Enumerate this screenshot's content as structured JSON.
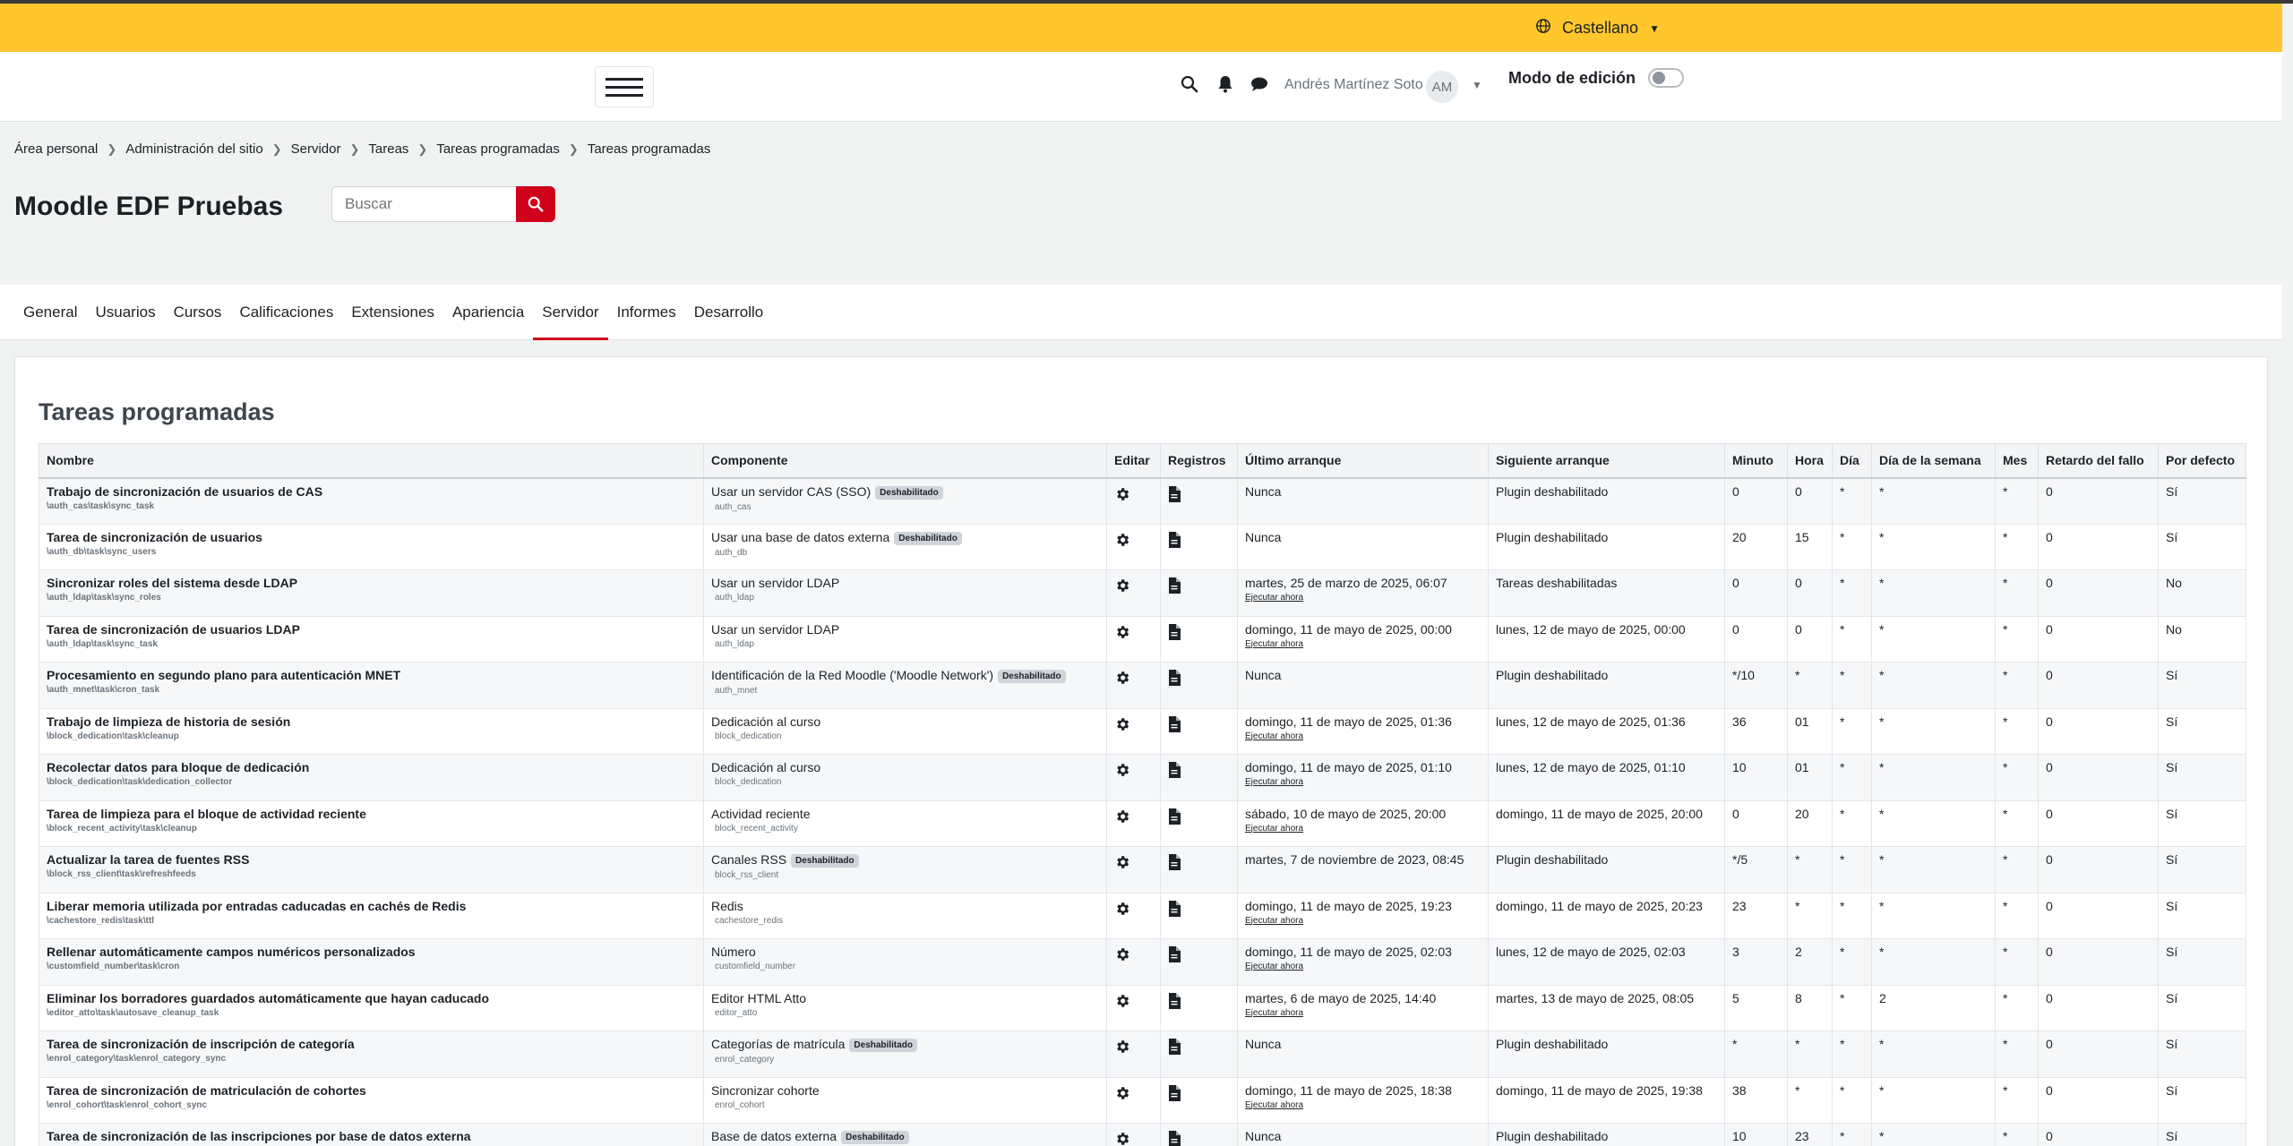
{
  "lang": {
    "label": "Castellano",
    "icon": "globe-icon"
  },
  "navbar": {
    "user_name": "Andrés Martínez Soto",
    "user_initials": "AM",
    "edit_mode_label": "Modo de edición",
    "icons": [
      "search-icon",
      "bell-icon",
      "chat-icon"
    ]
  },
  "breadcrumb": [
    "Área personal",
    "Administración del sitio",
    "Servidor",
    "Tareas",
    "Tareas programadas",
    "Tareas programadas"
  ],
  "site_title": "Moodle EDF Pruebas",
  "search": {
    "placeholder": "Buscar"
  },
  "tabs": [
    {
      "label": "General"
    },
    {
      "label": "Usuarios"
    },
    {
      "label": "Cursos"
    },
    {
      "label": "Calificaciones"
    },
    {
      "label": "Extensiones"
    },
    {
      "label": "Apariencia"
    },
    {
      "label": "Servidor",
      "active": true
    },
    {
      "label": "Informes"
    },
    {
      "label": "Desarrollo"
    }
  ],
  "page_title": "Tareas programadas",
  "table": {
    "headers": {
      "name": "Nombre",
      "component": "Componente",
      "edit": "Editar",
      "logs": "Registros",
      "last_run": "Último arranque",
      "next_run": "Siguiente arranque",
      "minute": "Minuto",
      "hour": "Hora",
      "day": "Día",
      "day_of_week": "Día de la semana",
      "month": "Mes",
      "fail_delay": "Retardo del fallo",
      "default": "Por defecto"
    },
    "run_now_label": "Ejecutar ahora",
    "rows": [
      {
        "name": "Trabajo de sincronización de usuarios de CAS",
        "class": "\\auth_cas\\task\\sync_task",
        "component": "Usar un servidor CAS (SSO)",
        "badge": "Deshabilitado",
        "component_id": "auth_cas",
        "last_run": "Nunca",
        "run_now": false,
        "next_run": "Plugin deshabilitado",
        "minute": "0",
        "hour": "0",
        "day": "*",
        "dow": "*",
        "month": "*",
        "fail_delay": "0",
        "default": "Sí"
      },
      {
        "name": "Tarea de sincronización de usuarios",
        "class": "\\auth_db\\task\\sync_users",
        "component": "Usar una base de datos externa",
        "badge": "Deshabilitado",
        "component_id": "auth_db",
        "last_run": "Nunca",
        "run_now": false,
        "next_run": "Plugin deshabilitado",
        "minute": "20",
        "hour": "15",
        "day": "*",
        "dow": "*",
        "month": "*",
        "fail_delay": "0",
        "default": "Sí"
      },
      {
        "name": "Sincronizar roles del sistema desde LDAP",
        "class": "\\auth_ldap\\task\\sync_roles",
        "component": "Usar un servidor LDAP",
        "badge": "",
        "component_id": "auth_ldap",
        "last_run": "martes, 25 de marzo de 2025, 06:07",
        "run_now": true,
        "next_run": "Tareas deshabilitadas",
        "minute": "0",
        "hour": "0",
        "day": "*",
        "dow": "*",
        "month": "*",
        "fail_delay": "0",
        "default": "No"
      },
      {
        "name": "Tarea de sincronización de usuarios LDAP",
        "class": "\\auth_ldap\\task\\sync_task",
        "component": "Usar un servidor LDAP",
        "badge": "",
        "component_id": "auth_ldap",
        "last_run": "domingo, 11 de mayo de 2025, 00:00",
        "run_now": true,
        "next_run": "lunes, 12 de mayo de 2025, 00:00",
        "minute": "0",
        "hour": "0",
        "day": "*",
        "dow": "*",
        "month": "*",
        "fail_delay": "0",
        "default": "No"
      },
      {
        "name": "Procesamiento en segundo plano para autenticación MNET",
        "class": "\\auth_mnet\\task\\cron_task",
        "component": "Identificación de la Red Moodle ('Moodle Network')",
        "badge": "Deshabilitado",
        "component_id": "auth_mnet",
        "last_run": "Nunca",
        "run_now": false,
        "next_run": "Plugin deshabilitado",
        "minute": "*/10",
        "hour": "*",
        "day": "*",
        "dow": "*",
        "month": "*",
        "fail_delay": "0",
        "default": "Sí"
      },
      {
        "name": "Trabajo de limpieza de historia de sesión",
        "class": "\\block_dedication\\task\\cleanup",
        "component": "Dedicación al curso",
        "badge": "",
        "component_id": "block_dedication",
        "last_run": "domingo, 11 de mayo de 2025, 01:36",
        "run_now": true,
        "next_run": "lunes, 12 de mayo de 2025, 01:36",
        "minute": "36",
        "hour": "01",
        "day": "*",
        "dow": "*",
        "month": "*",
        "fail_delay": "0",
        "default": "Sí"
      },
      {
        "name": "Recolectar datos para bloque de dedicación",
        "class": "\\block_dedication\\task\\dedication_collector",
        "component": "Dedicación al curso",
        "badge": "",
        "component_id": "block_dedication",
        "last_run": "domingo, 11 de mayo de 2025, 01:10",
        "run_now": true,
        "next_run": "lunes, 12 de mayo de 2025, 01:10",
        "minute": "10",
        "hour": "01",
        "day": "*",
        "dow": "*",
        "month": "*",
        "fail_delay": "0",
        "default": "Sí"
      },
      {
        "name": "Tarea de limpieza para el bloque de actividad reciente",
        "class": "\\block_recent_activity\\task\\cleanup",
        "component": "Actividad reciente",
        "badge": "",
        "component_id": "block_recent_activity",
        "last_run": "sábado, 10 de mayo de 2025, 20:00",
        "run_now": true,
        "next_run": "domingo, 11 de mayo de 2025, 20:00",
        "minute": "0",
        "hour": "20",
        "day": "*",
        "dow": "*",
        "month": "*",
        "fail_delay": "0",
        "default": "Sí"
      },
      {
        "name": "Actualizar la tarea de fuentes RSS",
        "class": "\\block_rss_client\\task\\refreshfeeds",
        "component": "Canales RSS",
        "badge": "Deshabilitado",
        "component_id": "block_rss_client",
        "last_run": "martes, 7 de noviembre de 2023, 08:45",
        "run_now": false,
        "next_run": "Plugin deshabilitado",
        "minute": "*/5",
        "hour": "*",
        "day": "*",
        "dow": "*",
        "month": "*",
        "fail_delay": "0",
        "default": "Sí"
      },
      {
        "name": "Liberar memoria utilizada por entradas caducadas en cachés de Redis",
        "class": "\\cachestore_redis\\task\\ttl",
        "component": "Redis",
        "badge": "",
        "component_id": "cachestore_redis",
        "last_run": "domingo, 11 de mayo de 2025, 19:23",
        "run_now": true,
        "next_run": "domingo, 11 de mayo de 2025, 20:23",
        "minute": "23",
        "hour": "*",
        "day": "*",
        "dow": "*",
        "month": "*",
        "fail_delay": "0",
        "default": "Sí"
      },
      {
        "name": "Rellenar automáticamente campos numéricos personalizados",
        "class": "\\customfield_number\\task\\cron",
        "component": "Número",
        "badge": "",
        "component_id": "customfield_number",
        "last_run": "domingo, 11 de mayo de 2025, 02:03",
        "run_now": true,
        "next_run": "lunes, 12 de mayo de 2025, 02:03",
        "minute": "3",
        "hour": "2",
        "day": "*",
        "dow": "*",
        "month": "*",
        "fail_delay": "0",
        "default": "Sí"
      },
      {
        "name": "Eliminar los borradores guardados automáticamente que hayan caducado",
        "class": "\\editor_atto\\task\\autosave_cleanup_task",
        "component": "Editor HTML Atto",
        "badge": "",
        "component_id": "editor_atto",
        "last_run": "martes, 6 de mayo de 2025, 14:40",
        "run_now": true,
        "next_run": "martes, 13 de mayo de 2025, 08:05",
        "minute": "5",
        "hour": "8",
        "day": "*",
        "dow": "2",
        "month": "*",
        "fail_delay": "0",
        "default": "Sí"
      },
      {
        "name": "Tarea de sincronización de inscripción de categoría",
        "class": "\\enrol_category\\task\\enrol_category_sync",
        "component": "Categorías de matrícula",
        "badge": "Deshabilitado",
        "component_id": "enrol_category",
        "last_run": "Nunca",
        "run_now": false,
        "next_run": "Plugin deshabilitado",
        "minute": "*",
        "hour": "*",
        "day": "*",
        "dow": "*",
        "month": "*",
        "fail_delay": "0",
        "default": "Sí"
      },
      {
        "name": "Tarea de sincronización de matriculación de cohortes",
        "class": "\\enrol_cohort\\task\\enrol_cohort_sync",
        "component": "Sincronizar cohorte",
        "badge": "",
        "component_id": "enrol_cohort",
        "last_run": "domingo, 11 de mayo de 2025, 18:38",
        "run_now": true,
        "next_run": "domingo, 11 de mayo de 2025, 19:38",
        "minute": "38",
        "hour": "*",
        "day": "*",
        "dow": "*",
        "month": "*",
        "fail_delay": "0",
        "default": "Sí"
      },
      {
        "name": "Tarea de sincronización de las inscripciones por base de datos externa",
        "class": "",
        "component": "Base de datos externa",
        "badge": "Deshabilitado",
        "component_id": "",
        "last_run": "Nunca",
        "run_now": false,
        "next_run": "Plugin deshabilitado",
        "minute": "10",
        "hour": "23",
        "day": "*",
        "dow": "*",
        "month": "*",
        "fail_delay": "0",
        "default": "Sí"
      }
    ]
  }
}
